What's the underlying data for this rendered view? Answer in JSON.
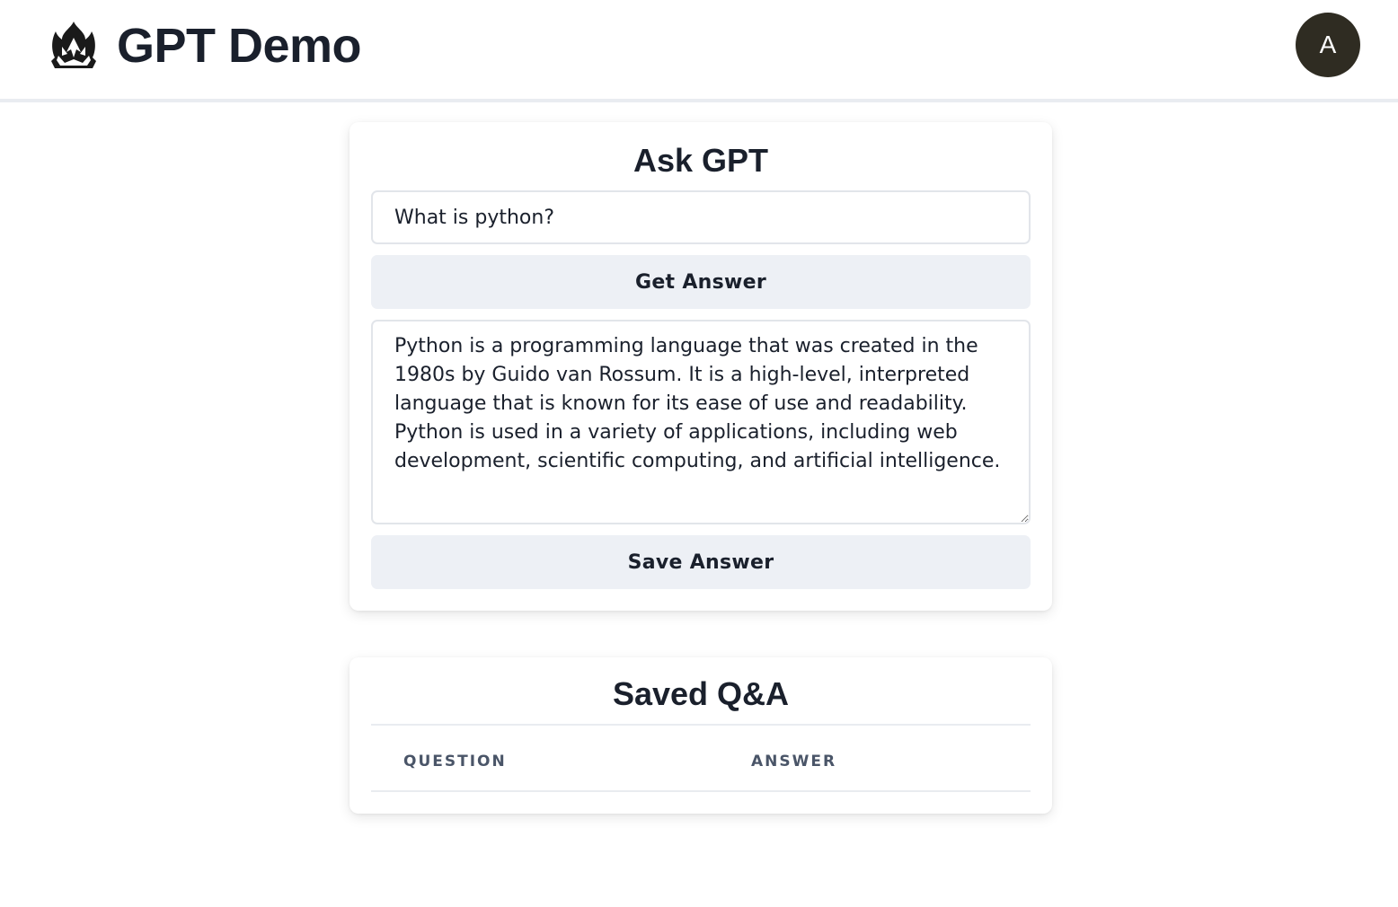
{
  "header": {
    "title": "GPT Demo",
    "logo_icon": "flame-crown-logo-icon",
    "avatar_letter": "A",
    "avatar_color": "#2f2c22"
  },
  "ask": {
    "title": "Ask GPT",
    "question_value": "What is python?",
    "get_answer_label": "Get Answer",
    "answer_value": "Python is a programming language that was created in the 1980s by Guido van Rossum. It is a high-level, interpreted language that is known for its ease of use and readability. Python is used in a variety of applications, including web development, scientific computing, and artificial intelligence.",
    "save_answer_label": "Save Answer",
    "button_color": "#edf0f5"
  },
  "saved": {
    "title": "Saved Q&A",
    "columns": [
      "QUESTION",
      "ANSWER"
    ],
    "rows": []
  }
}
